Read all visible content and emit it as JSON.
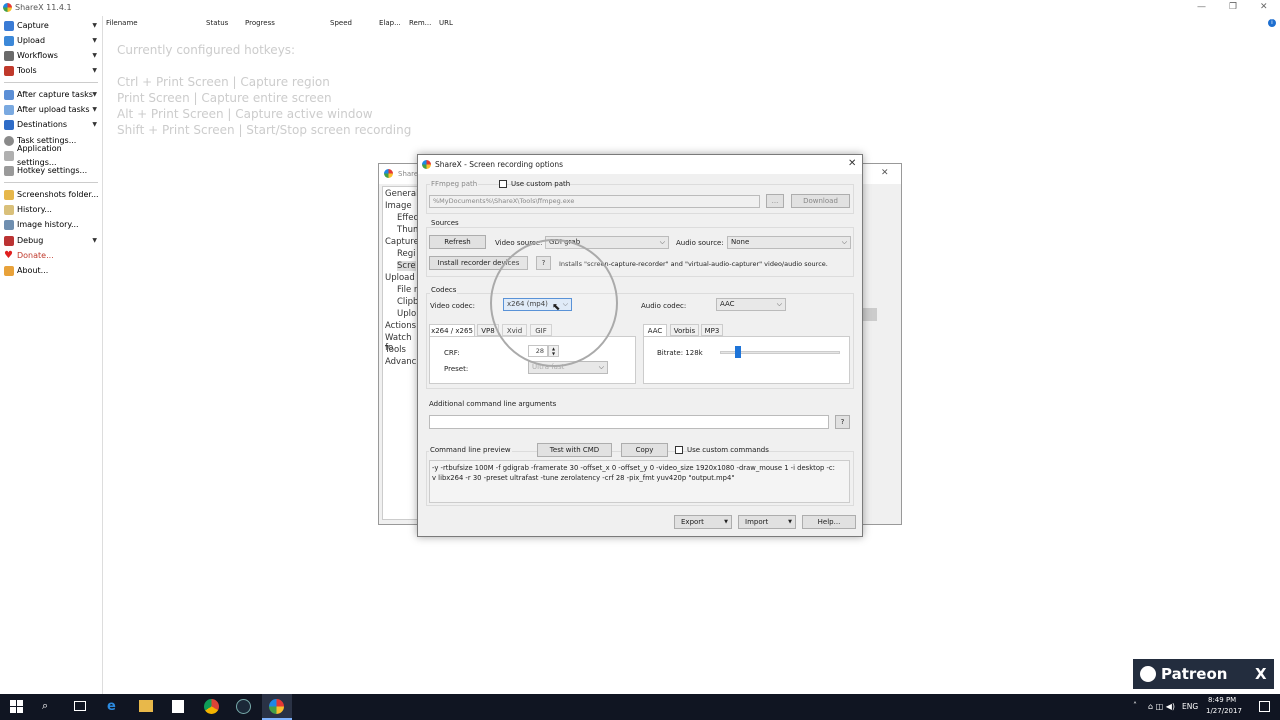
{
  "window": {
    "title": "ShareX 11.4.1"
  },
  "sidebar": {
    "items": [
      {
        "label": "Capture",
        "arrow": true
      },
      {
        "label": "Upload",
        "arrow": true
      },
      {
        "label": "Workflows",
        "arrow": true
      },
      {
        "label": "Tools",
        "arrow": true
      },
      {
        "label": "After capture tasks",
        "arrow": true
      },
      {
        "label": "After upload tasks",
        "arrow": true
      },
      {
        "label": "Destinations",
        "arrow": true
      },
      {
        "label": "Task settings...",
        "arrow": false
      },
      {
        "label": "Application settings...",
        "arrow": false
      },
      {
        "label": "Hotkey settings...",
        "arrow": false
      },
      {
        "label": "Screenshots folder...",
        "arrow": false
      },
      {
        "label": "History...",
        "arrow": false
      },
      {
        "label": "Image history...",
        "arrow": false
      },
      {
        "label": "Debug",
        "arrow": true
      },
      {
        "label": "Donate...",
        "arrow": false
      },
      {
        "label": "About...",
        "arrow": false
      }
    ]
  },
  "list_headers": [
    "Filename",
    "Status",
    "Progress",
    "Speed",
    "Elap...",
    "Rem...",
    "URL"
  ],
  "hotkeys": {
    "title": "Currently configured hotkeys:",
    "lines": [
      "Ctrl + Print Screen  |  Capture region",
      "Print Screen  |  Capture entire screen",
      "Alt + Print Screen  |  Capture active window",
      "Shift + Print Screen  |  Start/Stop screen recording"
    ]
  },
  "back_window": {
    "title": "Share",
    "items": [
      "General",
      "Image",
      "Effec",
      "Thum",
      "Capture",
      "Regi",
      "Scre",
      "Upload",
      "File n",
      "Clipb",
      "Uplo",
      "Actions",
      "Watch fo",
      "Tools",
      "Advanc"
    ]
  },
  "dialog": {
    "title": "ShareX - Screen recording options",
    "ffmpeg": {
      "group": "FFmpeg path",
      "use_custom_path": "Use custom path",
      "path": "%MyDocuments%\\ShareX\\Tools\\ffmpeg.exe",
      "browse": "...",
      "download": "Download"
    },
    "sources": {
      "group": "Sources",
      "refresh": "Refresh",
      "video_source_label": "Video source:",
      "video_source": "GDI grab",
      "audio_source_label": "Audio source:",
      "audio_source": "None",
      "install": "Install recorder devices",
      "help": "?",
      "install_note": "Installs \"screen-capture-recorder\" and \"virtual-audio-capturer\" video/audio source."
    },
    "codecs": {
      "group": "Codecs",
      "video_codec_label": "Video codec:",
      "video_codec": "x264 (mp4)",
      "audio_codec_label": "Audio codec:",
      "audio_codec": "AAC",
      "video_tabs": [
        "x264 / x265",
        "VP8",
        "Xvid",
        "GIF"
      ],
      "crf_label": "CRF:",
      "crf": "28",
      "preset_label": "Preset:",
      "preset": "Ultra fast",
      "audio_tabs": [
        "AAC",
        "Vorbis",
        "MP3"
      ],
      "bitrate_label": "Bitrate: 128k",
      "bitrate_fraction": 0.15
    },
    "args": {
      "label": "Additional command line arguments",
      "value": "",
      "help": "?"
    },
    "preview": {
      "label": "Command line preview",
      "test": "Test with CMD",
      "copy": "Copy",
      "use_custom": "Use custom commands",
      "text": "-y -rtbufsize 100M -f gdigrab -framerate 30 -offset_x 0 -offset_y 0 -video_size 1920x1080 -draw_mouse 1 -i desktop -c:v libx264 -r 30 -preset ultrafast -tune zerolatency -crf 28 -pix_fmt yuv420p \"output.mp4\""
    },
    "footer": {
      "export": "Export",
      "import": "Import",
      "help": "Help..."
    }
  },
  "taskbar": {
    "lang": "ENG",
    "time": "8:49 PM",
    "date": "1/27/2017"
  },
  "overlay": {
    "patreon": "Patreon",
    "x": "X"
  }
}
